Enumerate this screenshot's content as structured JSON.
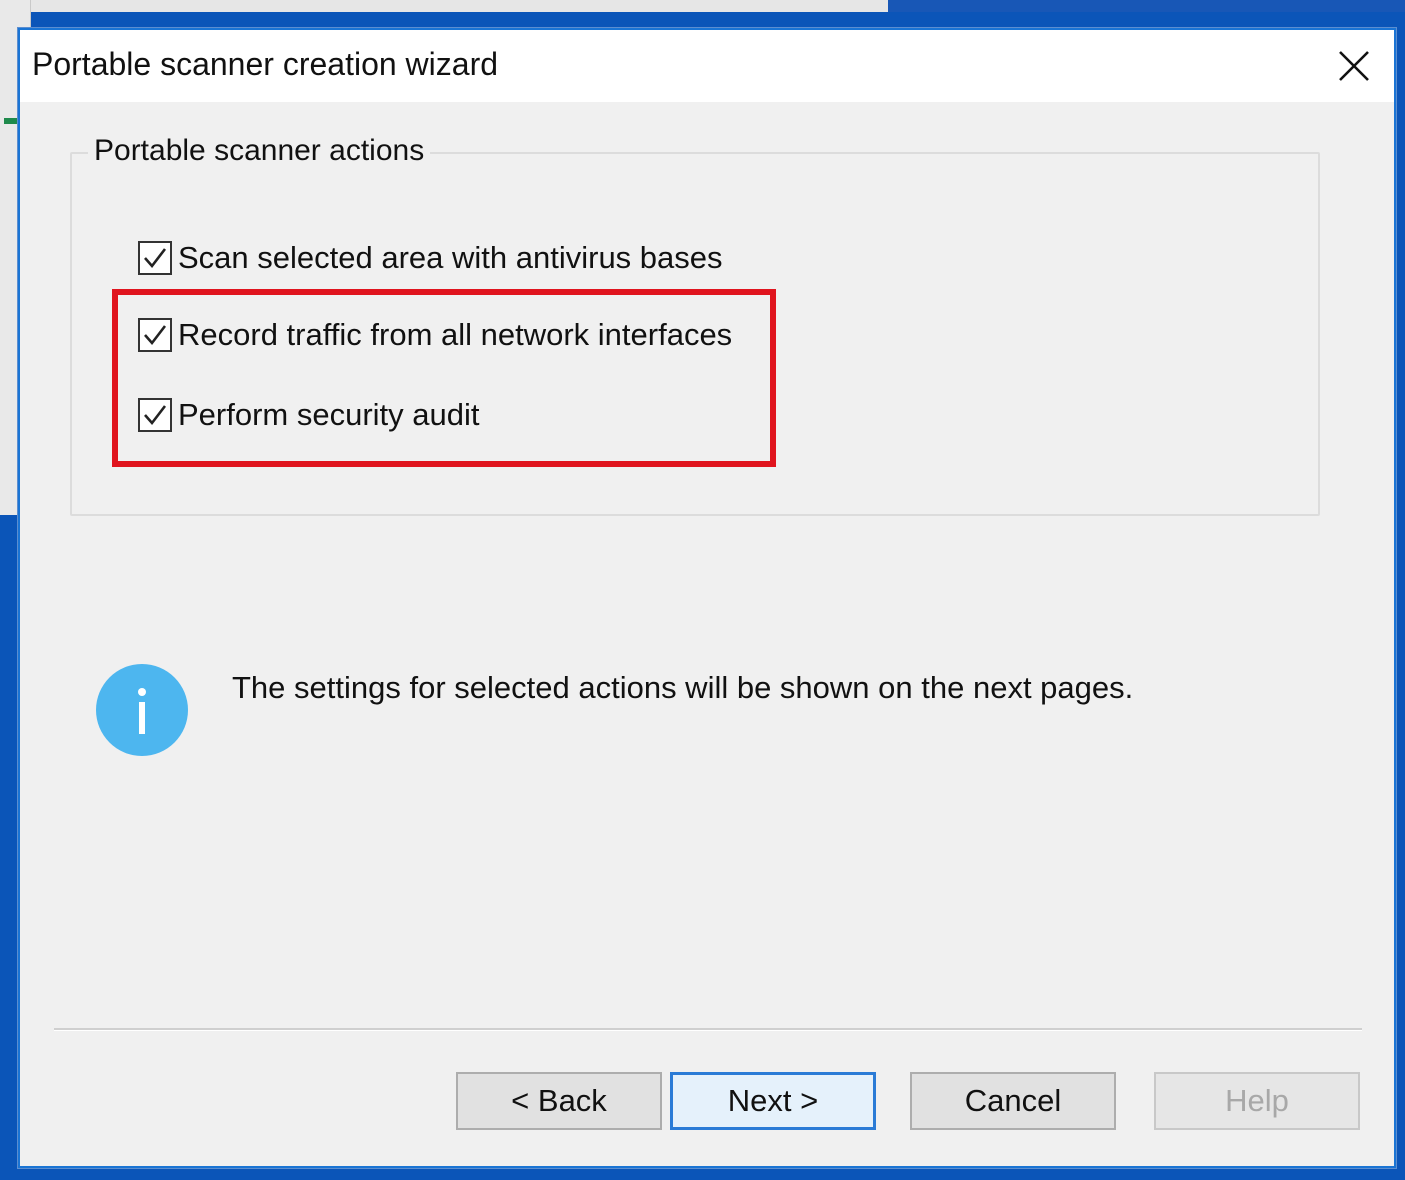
{
  "dialog": {
    "title": "Portable scanner creation wizard",
    "close_icon": "close-icon"
  },
  "group": {
    "legend": "Portable scanner actions",
    "items": [
      {
        "label": "Scan selected area with antivirus bases",
        "checked": true
      },
      {
        "label": "Record traffic from all network interfaces",
        "checked": true
      },
      {
        "label": "Perform security audit",
        "checked": true
      }
    ]
  },
  "info": {
    "icon": "info-icon",
    "text": "The settings for selected actions will be shown on the next pages."
  },
  "buttons": {
    "back": "< Back",
    "next": "Next >",
    "cancel": "Cancel",
    "help": "Help"
  },
  "colors": {
    "highlight": "#e0141e",
    "info_icon": "#4db6ef",
    "accent": "#2a7bd6"
  }
}
